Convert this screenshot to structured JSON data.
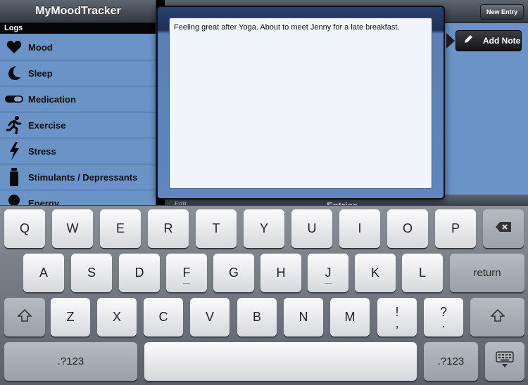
{
  "sidebar": {
    "title": "MyMoodTracker",
    "section": "Logs",
    "items": [
      {
        "label": "Mood",
        "icon": "heart-icon"
      },
      {
        "label": "Sleep",
        "icon": "moon-icon"
      },
      {
        "label": "Medication",
        "icon": "pill-icon"
      },
      {
        "label": "Exercise",
        "icon": "runner-icon"
      },
      {
        "label": "Stress",
        "icon": "lightning-icon"
      },
      {
        "label": "Stimulants / Depressants",
        "icon": "bottle-icon"
      },
      {
        "label": "Energy",
        "icon": "bulb-icon"
      }
    ]
  },
  "right": {
    "new_entry_label": "New Entry",
    "add_note_label": "Add Note",
    "entries_title": "Entries",
    "edit_label": "Edit"
  },
  "note": {
    "text": "Feeling great after Yoga. About to meet Jenny for a late breakfast."
  },
  "keyboard": {
    "row1": [
      "Q",
      "W",
      "E",
      "R",
      "T",
      "Y",
      "U",
      "I",
      "O",
      "P"
    ],
    "row2": [
      "A",
      "S",
      "D",
      "F",
      "G",
      "H",
      "J",
      "K",
      "L"
    ],
    "row3": [
      "Z",
      "X",
      "C",
      "V",
      "B",
      "N",
      "M"
    ],
    "return_label": "return",
    "numbers_label": ".?123",
    "punct1_top": "!",
    "punct1_bottom": ",",
    "punct2_top": "?",
    "punct2_bottom": "."
  }
}
